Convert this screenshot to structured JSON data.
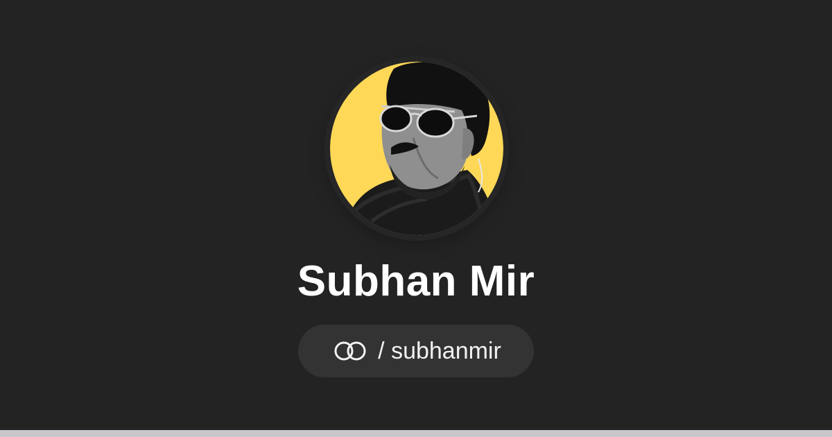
{
  "profile": {
    "name": "Subhan Mir",
    "handle_text": "/ subhanmir",
    "avatar_icon": "avatar-photo",
    "logo_icon": "linked-rings-icon"
  },
  "colors": {
    "background": "#232323",
    "avatar_accent": "#FFD857",
    "pill_background": "#333333",
    "text": "#FFFFFF",
    "bottom_bar": "#C9C7CC"
  }
}
